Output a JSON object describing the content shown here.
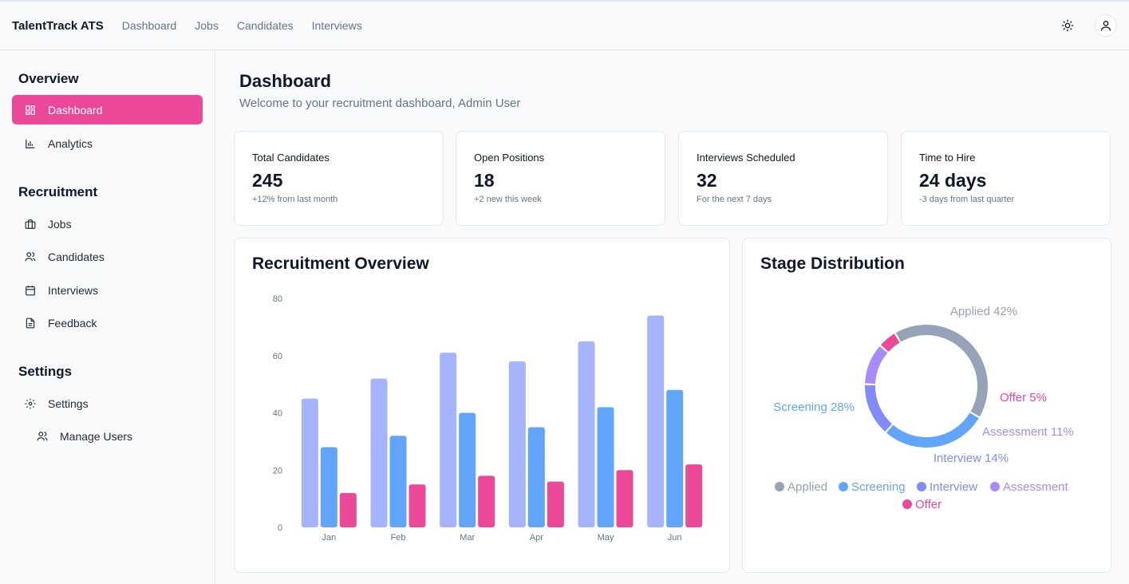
{
  "app": {
    "brand": "TalentTrack ATS"
  },
  "topnav": {
    "links": [
      "Dashboard",
      "Jobs",
      "Candidates",
      "Interviews"
    ]
  },
  "sidebar": {
    "sections": [
      {
        "title": "Overview",
        "items": [
          {
            "label": "Dashboard",
            "icon": "dashboard-icon",
            "active": true
          },
          {
            "label": "Analytics",
            "icon": "bar-chart-icon"
          }
        ]
      },
      {
        "title": "Recruitment",
        "items": [
          {
            "label": "Jobs",
            "icon": "briefcase-icon"
          },
          {
            "label": "Candidates",
            "icon": "users-icon"
          },
          {
            "label": "Interviews",
            "icon": "calendar-icon"
          },
          {
            "label": "Feedback",
            "icon": "file-icon"
          }
        ]
      },
      {
        "title": "Settings",
        "items": [
          {
            "label": "Settings",
            "icon": "gear-icon"
          },
          {
            "label": "Manage Users",
            "icon": "users-icon"
          }
        ]
      }
    ]
  },
  "page": {
    "title": "Dashboard",
    "subtitle": "Welcome to your recruitment dashboard, Admin User"
  },
  "stats": [
    {
      "label": "Total Candidates",
      "value": "245",
      "note": "+12% from last month"
    },
    {
      "label": "Open Positions",
      "value": "18",
      "note": "+2 new this week"
    },
    {
      "label": "Interviews Scheduled",
      "value": "32",
      "note": "For the next 7 days"
    },
    {
      "label": "Time to Hire",
      "value": "24 days",
      "note": "-3 days from last quarter"
    }
  ],
  "colors": {
    "accent": "#ec4899",
    "series1": "#a5b4fc",
    "series2": "#60a5fa",
    "series3": "#ec4899",
    "applied": "#94a3b8",
    "screening": "#60a5fa",
    "interview": "#818cf8",
    "assessment": "#a78bfa",
    "offer": "#ec4899"
  },
  "chart_data": [
    {
      "type": "bar",
      "title": "Recruitment Overview",
      "categories": [
        "Jan",
        "Feb",
        "Mar",
        "Apr",
        "May",
        "Jun"
      ],
      "ylim": [
        0,
        80
      ],
      "yticks": [
        0,
        20,
        40,
        60,
        80
      ],
      "series": [
        {
          "values": [
            45,
            52,
            61,
            58,
            65,
            74
          ]
        },
        {
          "values": [
            28,
            32,
            40,
            35,
            42,
            48
          ]
        },
        {
          "values": [
            12,
            15,
            18,
            16,
            20,
            22
          ]
        }
      ]
    },
    {
      "type": "pie",
      "title": "Stage Distribution",
      "labels": [
        "Applied",
        "Screening",
        "Interview",
        "Assessment",
        "Offer"
      ],
      "values": [
        42,
        28,
        14,
        11,
        5
      ],
      "slice_labels": [
        "Applied 42%",
        "Screening 28%",
        "Interview 14%",
        "Assessment 11%",
        "Offer 5%"
      ]
    }
  ]
}
